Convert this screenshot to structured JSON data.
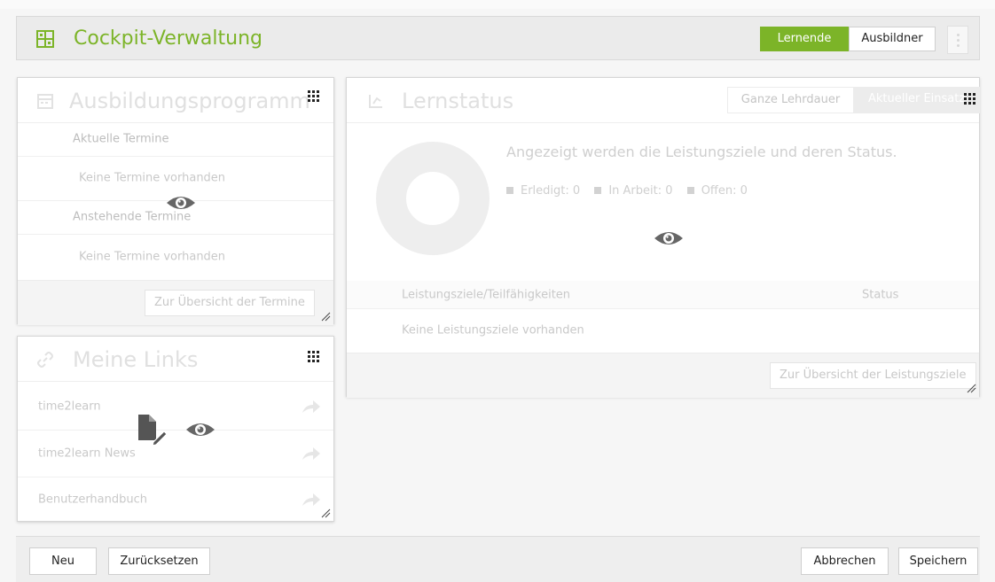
{
  "header": {
    "title": "Cockpit-Verwaltung",
    "toggle_lernende": "Lernende",
    "toggle_ausbildner": "Ausbildner"
  },
  "ausbildungsprogramm": {
    "title": "Ausbildungsprogramm",
    "current_label": "Aktuelle Termine",
    "current_empty": "Keine Termine vorhanden",
    "upcoming_label": "Anstehende Termine",
    "upcoming_empty": "Keine Termine vorhanden",
    "overview_button": "Zur Übersicht der Termine"
  },
  "lernstatus": {
    "title": "Lernstatus",
    "tab_total": "Ganze Lehrdauer",
    "tab_current": "Aktueller Einsatz",
    "description": "Angezeigt werden die Leistungsziele und deren Status.",
    "legend": [
      {
        "label": "Erledigt:",
        "value": "0"
      },
      {
        "label": "In Arbeit:",
        "value": "0"
      },
      {
        "label": "Offen:",
        "value": "0"
      }
    ],
    "col_goals": "Leistungsziele/Teilfähigkeiten",
    "col_status": "Status",
    "empty_goals": "Keine Leistungsziele vorhanden",
    "overview_button": "Zur Übersicht der Leistungsziele"
  },
  "links": {
    "title": "Meine Links",
    "items": [
      "time2learn",
      "time2learn News",
      "Benutzerhandbuch"
    ]
  },
  "footer": {
    "new": "Neu",
    "reset": "Zurücksetzen",
    "cancel": "Abbrechen",
    "save": "Speichern"
  },
  "colors": {
    "accent_green": "#7cb428",
    "ghost_text": "#c9c9c9"
  }
}
